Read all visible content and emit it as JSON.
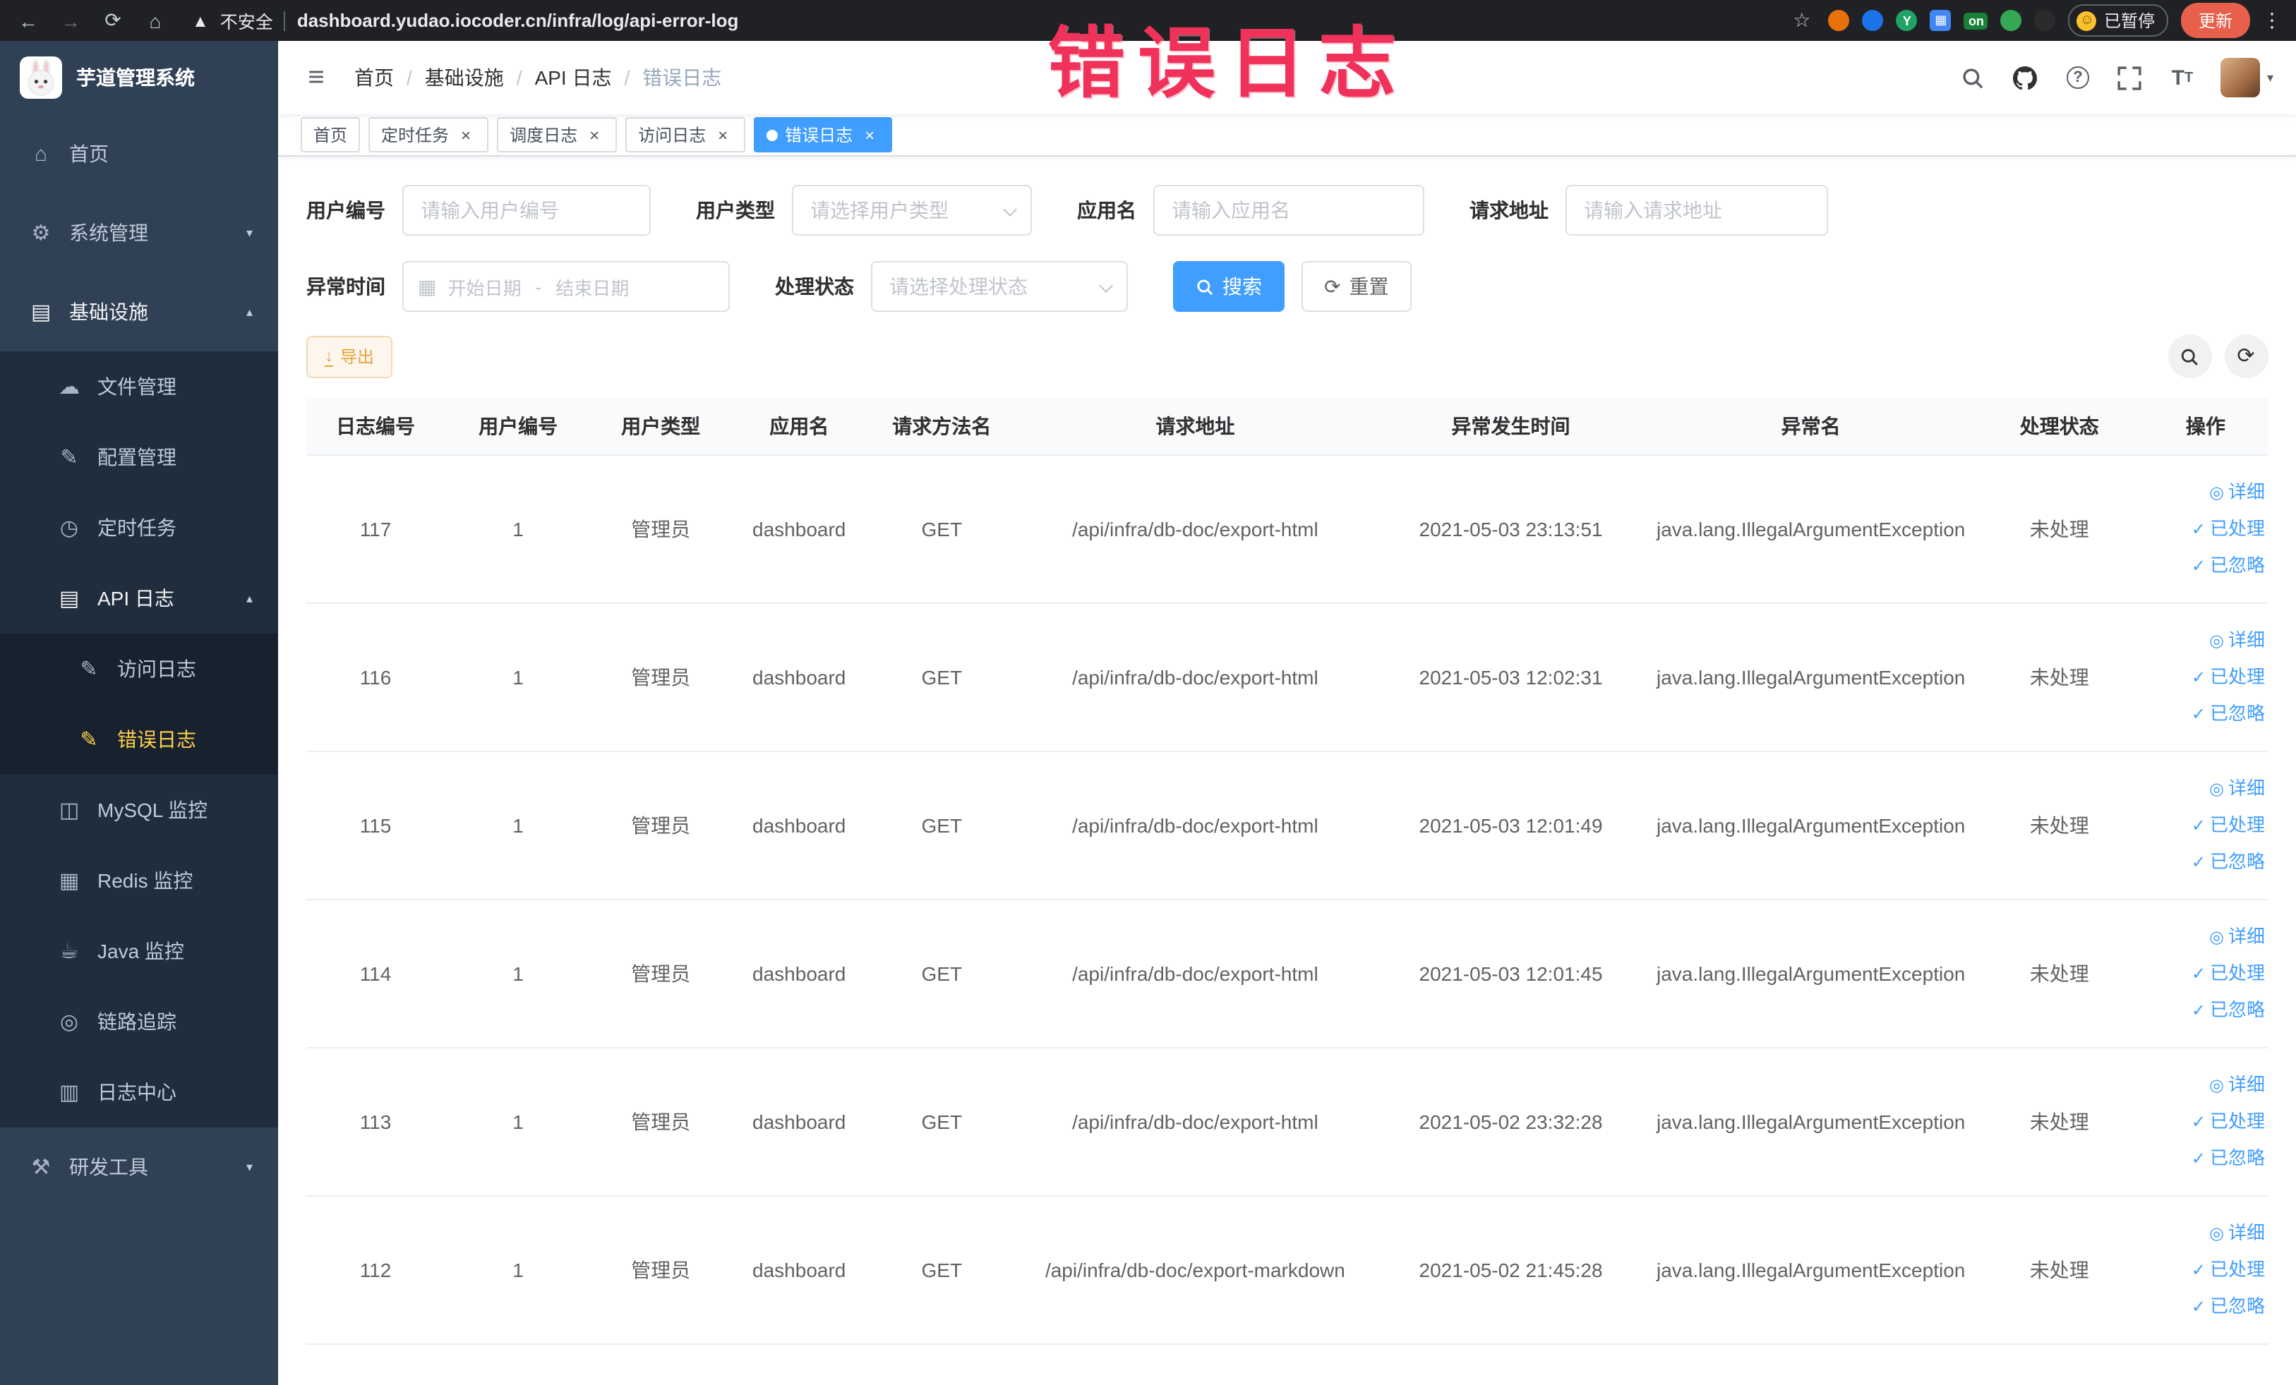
{
  "browser": {
    "security_label": "不安全",
    "url": "dashboard.yudao.iocoder.cn/infra/log/api-error-log",
    "extension_on_badge": "on",
    "paused_badge": "已暂停",
    "update_button": "更新"
  },
  "annotation": {
    "text": "错误日志",
    "color": "#f0325a"
  },
  "sidebar": {
    "logo_title": "芋道管理系统",
    "items": {
      "home": "首页",
      "system": "系统管理",
      "infra": "基础设施",
      "file": "文件管理",
      "config": "配置管理",
      "job": "定时任务",
      "api_log": "API 日志",
      "access_log": "访问日志",
      "error_log": "错误日志",
      "mysql": "MySQL 监控",
      "redis": "Redis 监控",
      "java": "Java 监控",
      "trace": "链路追踪",
      "log_center": "日志中心",
      "dev_tools": "研发工具"
    }
  },
  "header": {
    "breadcrumb": [
      "首页",
      "基础设施",
      "API 日志",
      "错误日志"
    ]
  },
  "tabs": [
    {
      "label": "首页",
      "closable": false,
      "active": false
    },
    {
      "label": "定时任务",
      "closable": true,
      "active": false
    },
    {
      "label": "调度日志",
      "closable": true,
      "active": false
    },
    {
      "label": "访问日志",
      "closable": true,
      "active": false
    },
    {
      "label": "错误日志",
      "closable": true,
      "active": true
    }
  ],
  "filters": {
    "user_id_label": "用户编号",
    "user_id_placeholder": "请输入用户编号",
    "user_type_label": "用户类型",
    "user_type_placeholder": "请选择用户类型",
    "app_name_label": "应用名",
    "app_name_placeholder": "请输入应用名",
    "request_url_label": "请求地址",
    "request_url_placeholder": "请输入请求地址",
    "exception_time_label": "异常时间",
    "date_start_placeholder": "开始日期",
    "date_separator": "-",
    "date_end_placeholder": "结束日期",
    "process_status_label": "处理状态",
    "process_status_placeholder": "请选择处理状态",
    "search_button": "搜索",
    "reset_button": "重置"
  },
  "toolbar": {
    "export_button": "导出"
  },
  "table": {
    "columns": [
      "日志编号",
      "用户编号",
      "用户类型",
      "应用名",
      "请求方法名",
      "请求地址",
      "异常发生时间",
      "异常名",
      "处理状态",
      "操作"
    ],
    "row_actions": [
      "详细",
      "已处理",
      "已忽略"
    ],
    "rows": [
      {
        "id": "117",
        "user_id": "1",
        "user_type": "管理员",
        "app": "dashboard",
        "method": "GET",
        "url": "/api/infra/db-doc/export-html",
        "time": "2021-05-03 23:13:51",
        "exception": "java.lang.IllegalArgumentException",
        "status": "未处理"
      },
      {
        "id": "116",
        "user_id": "1",
        "user_type": "管理员",
        "app": "dashboard",
        "method": "GET",
        "url": "/api/infra/db-doc/export-html",
        "time": "2021-05-03 12:02:31",
        "exception": "java.lang.IllegalArgumentException",
        "status": "未处理"
      },
      {
        "id": "115",
        "user_id": "1",
        "user_type": "管理员",
        "app": "dashboard",
        "method": "GET",
        "url": "/api/infra/db-doc/export-html",
        "time": "2021-05-03 12:01:49",
        "exception": "java.lang.IllegalArgumentException",
        "status": "未处理"
      },
      {
        "id": "114",
        "user_id": "1",
        "user_type": "管理员",
        "app": "dashboard",
        "method": "GET",
        "url": "/api/infra/db-doc/export-html",
        "time": "2021-05-03 12:01:45",
        "exception": "java.lang.IllegalArgumentException",
        "status": "未处理"
      },
      {
        "id": "113",
        "user_id": "1",
        "user_type": "管理员",
        "app": "dashboard",
        "method": "GET",
        "url": "/api/infra/db-doc/export-html",
        "time": "2021-05-02 23:32:28",
        "exception": "java.lang.IllegalArgumentException",
        "status": "未处理"
      },
      {
        "id": "112",
        "user_id": "1",
        "user_type": "管理员",
        "app": "dashboard",
        "method": "GET",
        "url": "/api/infra/db-doc/export-markdown",
        "time": "2021-05-02 21:45:28",
        "exception": "java.lang.IllegalArgumentException",
        "status": "未处理"
      }
    ]
  }
}
